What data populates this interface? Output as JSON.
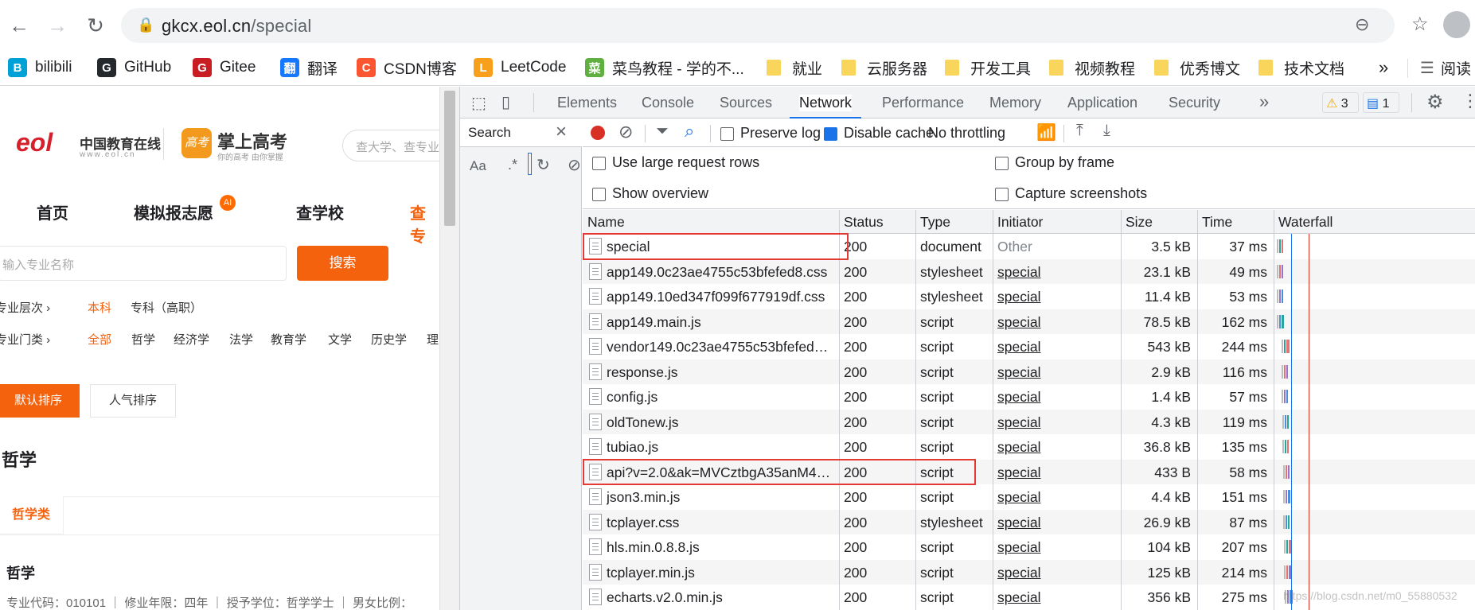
{
  "browser": {
    "url_host": "gkcx.eol.cn",
    "url_path": "/special",
    "bookmarks": [
      {
        "label": "bilibili",
        "icon": "bilibili-icon",
        "color": "#00a1d6"
      },
      {
        "label": "GitHub",
        "icon": "github-icon",
        "color": "#24292e"
      },
      {
        "label": "Gitee",
        "icon": "gitee-icon",
        "color": "#c71d23"
      },
      {
        "label": "翻译",
        "icon": "translate-icon",
        "color": "#1677ff"
      },
      {
        "label": "CSDN博客",
        "icon": "csdn-icon",
        "color": "#fc5531"
      },
      {
        "label": "LeetCode",
        "icon": "leetcode-icon",
        "color": "#f89f1b"
      },
      {
        "label": "菜鸟教程 - 学的不...",
        "icon": "runoob-icon",
        "color": "#5fb041"
      },
      {
        "label": "就业",
        "icon": "folder-icon"
      },
      {
        "label": "云服务器",
        "icon": "folder-icon"
      },
      {
        "label": "开发工具",
        "icon": "folder-icon"
      },
      {
        "label": "视频教程",
        "icon": "folder-icon"
      },
      {
        "label": "优秀博文",
        "icon": "folder-icon"
      },
      {
        "label": "技术文档",
        "icon": "folder-icon"
      }
    ],
    "more_label": "»",
    "reading_list_label": "阅读"
  },
  "site": {
    "logo_text": "中国教育在线",
    "logo_sub": "www.eol.cn",
    "brand": "掌上高考",
    "brand_sub": "你的高考 由你掌握",
    "search_placeholder": "查大学、查专业",
    "nav": [
      "首页",
      "模拟报志愿",
      "查学校",
      "查专"
    ],
    "nav_ai": "AI",
    "major_placeholder": "输入专业名称",
    "search_btn": "搜索",
    "level_label": "专业层次",
    "levels": [
      "本科",
      "专科（高职）"
    ],
    "category_label": "专业门类",
    "categories": [
      "全部",
      "哲学",
      "经济学",
      "法学",
      "教育学",
      "文学",
      "历史学",
      "理"
    ],
    "sort_default": "默认排序",
    "sort_popular": "人气排序",
    "section_title": "哲学",
    "sub_tab": "哲学类",
    "major_name": "哲学",
    "major_info": "专业代码：010101 ｜ 修业年限：四年 ｜ 授予学位：哲学学士 ｜ 男女比例："
  },
  "devtools": {
    "tabs": [
      "Elements",
      "Console",
      "Sources",
      "Network",
      "Performance",
      "Memory",
      "Application",
      "Security"
    ],
    "active_tab": "Network",
    "warnings": "3",
    "messages": "1",
    "search_title": "Search",
    "search_opt_case": "Aa",
    "search_opt_regex": ".*",
    "preserve_log": "Preserve log",
    "disable_cache": "Disable cache",
    "throttling": "No throttling",
    "large_rows": "Use large request rows",
    "show_overview": "Show overview",
    "group_by_frame": "Group by frame",
    "capture_screenshots": "Capture screenshots",
    "columns": [
      "Name",
      "Status",
      "Type",
      "Initiator",
      "Size",
      "Time",
      "Waterfall"
    ],
    "requests": [
      {
        "name": "special",
        "status": "200",
        "type": "document",
        "initiator": "Other",
        "size": "3.5 kB",
        "time": "37 ms"
      },
      {
        "name": "app149.0c23ae4755c53bfefed8.css",
        "status": "200",
        "type": "stylesheet",
        "initiator": "special",
        "size": "23.1 kB",
        "time": "49 ms"
      },
      {
        "name": "app149.10ed347f099f677919df.css",
        "status": "200",
        "type": "stylesheet",
        "initiator": "special",
        "size": "11.4 kB",
        "time": "53 ms"
      },
      {
        "name": "app149.main.js",
        "status": "200",
        "type": "script",
        "initiator": "special",
        "size": "78.5 kB",
        "time": "162 ms"
      },
      {
        "name": "vendor149.0c23ae4755c53bfefed8.js",
        "status": "200",
        "type": "script",
        "initiator": "special",
        "size": "543 kB",
        "time": "244 ms"
      },
      {
        "name": "response.js",
        "status": "200",
        "type": "script",
        "initiator": "special",
        "size": "2.9 kB",
        "time": "116 ms"
      },
      {
        "name": "config.js",
        "status": "200",
        "type": "script",
        "initiator": "special",
        "size": "1.4 kB",
        "time": "57 ms"
      },
      {
        "name": "oldTonew.js",
        "status": "200",
        "type": "script",
        "initiator": "special",
        "size": "4.3 kB",
        "time": "119 ms"
      },
      {
        "name": "tubiao.js",
        "status": "200",
        "type": "script",
        "initiator": "special",
        "size": "36.8 kB",
        "time": "135 ms"
      },
      {
        "name": "api?v=2.0&ak=MVCztbgA35anM4ZFf11P...",
        "status": "200",
        "type": "script",
        "initiator": "special",
        "size": "433 B",
        "time": "58 ms"
      },
      {
        "name": "json3.min.js",
        "status": "200",
        "type": "script",
        "initiator": "special",
        "size": "4.4 kB",
        "time": "151 ms"
      },
      {
        "name": "tcplayer.css",
        "status": "200",
        "type": "stylesheet",
        "initiator": "special",
        "size": "26.9 kB",
        "time": "87 ms"
      },
      {
        "name": "hls.min.0.8.8.js",
        "status": "200",
        "type": "script",
        "initiator": "special",
        "size": "104 kB",
        "time": "207 ms"
      },
      {
        "name": "tcplayer.min.js",
        "status": "200",
        "type": "script",
        "initiator": "special",
        "size": "125 kB",
        "time": "214 ms"
      },
      {
        "name": "echarts.v2.0.min.js",
        "status": "200",
        "type": "script",
        "initiator": "special",
        "size": "356 kB",
        "time": "275 ms"
      }
    ],
    "highlighted_rows": [
      0,
      9
    ],
    "watermark": "https://blog.csdn.net/m0_55880532"
  }
}
